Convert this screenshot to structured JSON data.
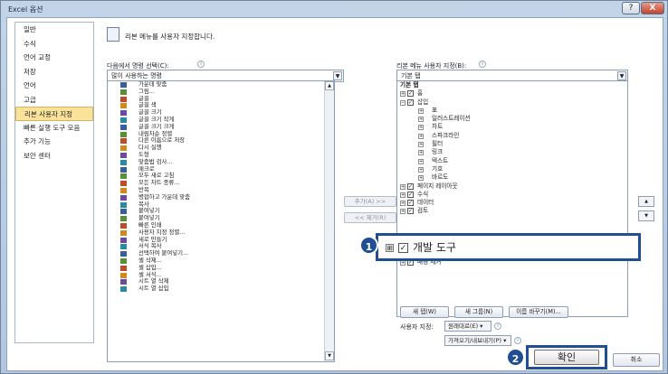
{
  "window": {
    "title": "Excel 옵션",
    "help_label": "?",
    "close_label": "X"
  },
  "nav": {
    "items": [
      "일반",
      "수식",
      "언어 교정",
      "저장",
      "언어",
      "고급",
      "리본 사용자 지정",
      "빠른 실행 도구 모음",
      "추가 기능",
      "보안 센터"
    ],
    "selected_index": 6
  },
  "header": {
    "text": "리본 메뉴를 사용자 지정합니다."
  },
  "left": {
    "label": "다음에서 명령 선택(C):",
    "dropdown_value": "많이 사용하는 명령",
    "commands": [
      {
        "label": "가운데 맞춤",
        "more": ""
      },
      {
        "label": "그림...",
        "more": ""
      },
      {
        "label": "글꼴",
        "more": "I▾"
      },
      {
        "label": "글꼴 색",
        "more": "▸"
      },
      {
        "label": "글꼴 크기",
        "more": "I▾"
      },
      {
        "label": "글꼴 크기 작게",
        "more": ""
      },
      {
        "label": "글꼴 크기 크게",
        "more": ""
      },
      {
        "label": "내림차순 정렬",
        "more": ""
      },
      {
        "label": "다른 이름으로 저장",
        "more": ""
      },
      {
        "label": "다시 실행",
        "more": "▸"
      },
      {
        "label": "도형",
        "more": "▸"
      },
      {
        "label": "맞춤법 검사...",
        "more": ""
      },
      {
        "label": "매크로",
        "more": ""
      },
      {
        "label": "모두 새로 고침",
        "more": ""
      },
      {
        "label": "모든 차트 종류...",
        "more": ""
      },
      {
        "label": "반복",
        "more": ""
      },
      {
        "label": "병합하고 가운데 맞춤",
        "more": ""
      },
      {
        "label": "복사",
        "more": ""
      },
      {
        "label": "붙여넣기",
        "more": ""
      },
      {
        "label": "붙여넣기",
        "more": "▸"
      },
      {
        "label": "빠른 인쇄",
        "more": ""
      },
      {
        "label": "사용자 지정 정렬...",
        "more": ""
      },
      {
        "label": "새로 만들기",
        "more": ""
      },
      {
        "label": "서식 복사",
        "more": ""
      },
      {
        "label": "선택하여 붙여넣기...",
        "more": ""
      },
      {
        "label": "셀 삭제...",
        "more": ""
      },
      {
        "label": "셀 삽입...",
        "more": ""
      },
      {
        "label": "셀 서식...",
        "more": ""
      },
      {
        "label": "시트 열 삭제",
        "more": ""
      },
      {
        "label": "시트 열 삽입",
        "more": ""
      }
    ]
  },
  "right": {
    "label": "리본 메뉴 사용자 지정(B):",
    "dropdown_value": "기본 탭",
    "tree_header": "기본 탭",
    "tabs_before": [
      {
        "label": "홈",
        "level": 0,
        "expand": "⊞",
        "checked": true
      },
      {
        "label": "삽입",
        "level": 0,
        "expand": "⊟",
        "checked": true
      },
      {
        "label": "표",
        "level": 1,
        "expand": "⊞",
        "checked": false
      },
      {
        "label": "일러스트레이션",
        "level": 1,
        "expand": "⊞",
        "checked": false
      },
      {
        "label": "차트",
        "level": 1,
        "expand": "⊞",
        "checked": false
      },
      {
        "label": "스파크라인",
        "level": 1,
        "expand": "⊞",
        "checked": false
      },
      {
        "label": "필터",
        "level": 1,
        "expand": "⊞",
        "checked": false
      },
      {
        "label": "링크",
        "level": 1,
        "expand": "⊞",
        "checked": false
      },
      {
        "label": "텍스트",
        "level": 1,
        "expand": "⊞",
        "checked": false
      },
      {
        "label": "기호",
        "level": 1,
        "expand": "⊞",
        "checked": false
      },
      {
        "label": "바르도",
        "level": 1,
        "expand": "⊞",
        "checked": false
      },
      {
        "label": "페이지 레이아웃",
        "level": 0,
        "expand": "⊞",
        "checked": true
      },
      {
        "label": "수식",
        "level": 0,
        "expand": "⊞",
        "checked": true
      },
      {
        "label": "데이터",
        "level": 0,
        "expand": "⊞",
        "checked": true
      },
      {
        "label": "검토",
        "level": 0,
        "expand": "⊞",
        "checked": true
      }
    ],
    "tabs_after": [
      {
        "label": "배경 제거",
        "level": 0,
        "expand": "⊞",
        "checked": true
      }
    ],
    "new_tab_label": "새 탭(W)",
    "new_group_label": "새 그룹(N)",
    "rename_label": "이름 바꾸기(M)...",
    "reset_label": "사용자 지정:",
    "reset_value": "원래대로(E) ▾",
    "import_export_value": "가져오기/내보내기(P) ▾"
  },
  "buttons": {
    "add_label": "추가(A) >>",
    "remove_label": "<< 제거(R)",
    "ok_label": "확인",
    "cancel_label": "취소",
    "up_label": "▲",
    "down_label": "▼"
  },
  "highlight": {
    "expand": "⊞",
    "check": "✓",
    "text": "개발 도구"
  },
  "badges": {
    "one": "1",
    "two": "2"
  },
  "colors": {
    "accent": "#1f4e93",
    "selection": "#fbe29a"
  }
}
